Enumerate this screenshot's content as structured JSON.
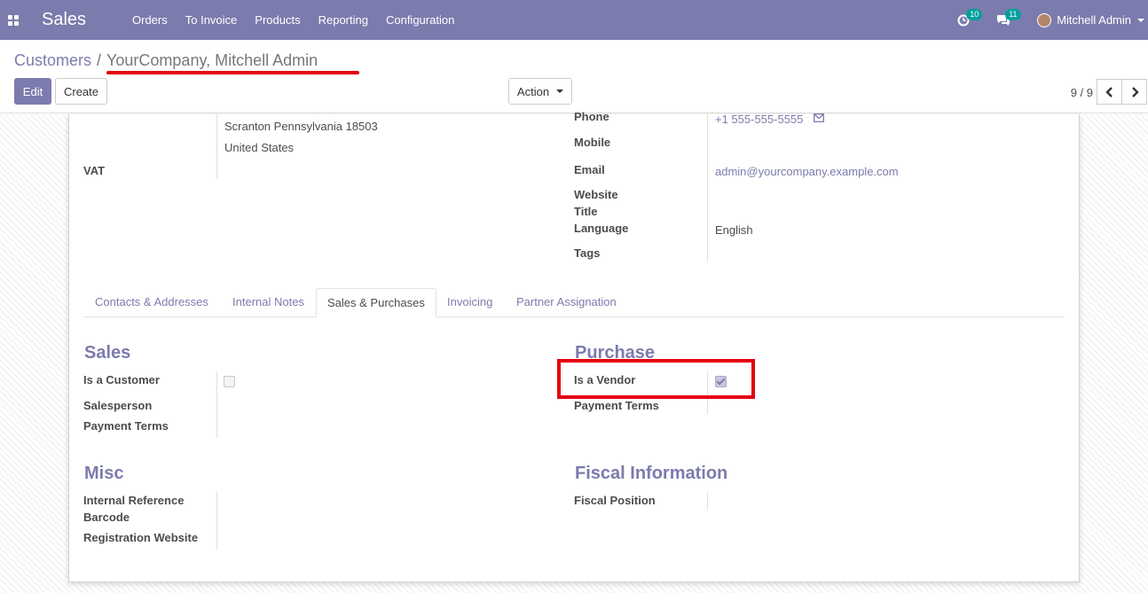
{
  "app": {
    "brand": "Sales"
  },
  "menu": [
    {
      "label": "Orders"
    },
    {
      "label": "To Invoice"
    },
    {
      "label": "Products"
    },
    {
      "label": "Reporting"
    },
    {
      "label": "Configuration"
    }
  ],
  "systray": {
    "activity_count": "10",
    "message_count": "11",
    "user_name": "Mitchell Admin"
  },
  "breadcrumb": {
    "parent": "Customers",
    "separator": "/",
    "current": "YourCompany, Mitchell Admin"
  },
  "buttons": {
    "edit": "Edit",
    "create": "Create",
    "action": "Action"
  },
  "pager": {
    "value": "9 / 9"
  },
  "address": {
    "city_line": "Scranton  Pennsylvania  18503",
    "country": "United States",
    "vat_label": "VAT"
  },
  "contact": {
    "phone_label": "Phone",
    "phone": "+1 555-555-5555",
    "mobile_label": "Mobile",
    "email_label": "Email",
    "email": "admin@yourcompany.example.com",
    "website_label": "Website",
    "title_label": "Title",
    "language_label": "Language",
    "language": "English",
    "tags_label": "Tags"
  },
  "tabs": [
    {
      "label": "Contacts & Addresses"
    },
    {
      "label": "Internal Notes"
    },
    {
      "label": "Sales & Purchases",
      "active": true
    },
    {
      "label": "Invoicing"
    },
    {
      "label": "Partner Assignation"
    }
  ],
  "sales": {
    "title": "Sales",
    "is_customer_label": "Is a Customer",
    "is_customer": false,
    "salesperson_label": "Salesperson",
    "payment_terms_label": "Payment Terms"
  },
  "purchase": {
    "title": "Purchase",
    "is_vendor_label": "Is a Vendor",
    "is_vendor": true,
    "payment_terms_label": "Payment Terms"
  },
  "misc": {
    "title": "Misc",
    "internal_reference_label": "Internal Reference",
    "barcode_label": "Barcode",
    "registration_website_label": "Registration Website"
  },
  "fiscal": {
    "title": "Fiscal Information",
    "fiscal_position_label": "Fiscal Position"
  },
  "colors": {
    "brand": "#7c7bad",
    "highlight": "#e4000f",
    "badge": "#00a09d"
  }
}
